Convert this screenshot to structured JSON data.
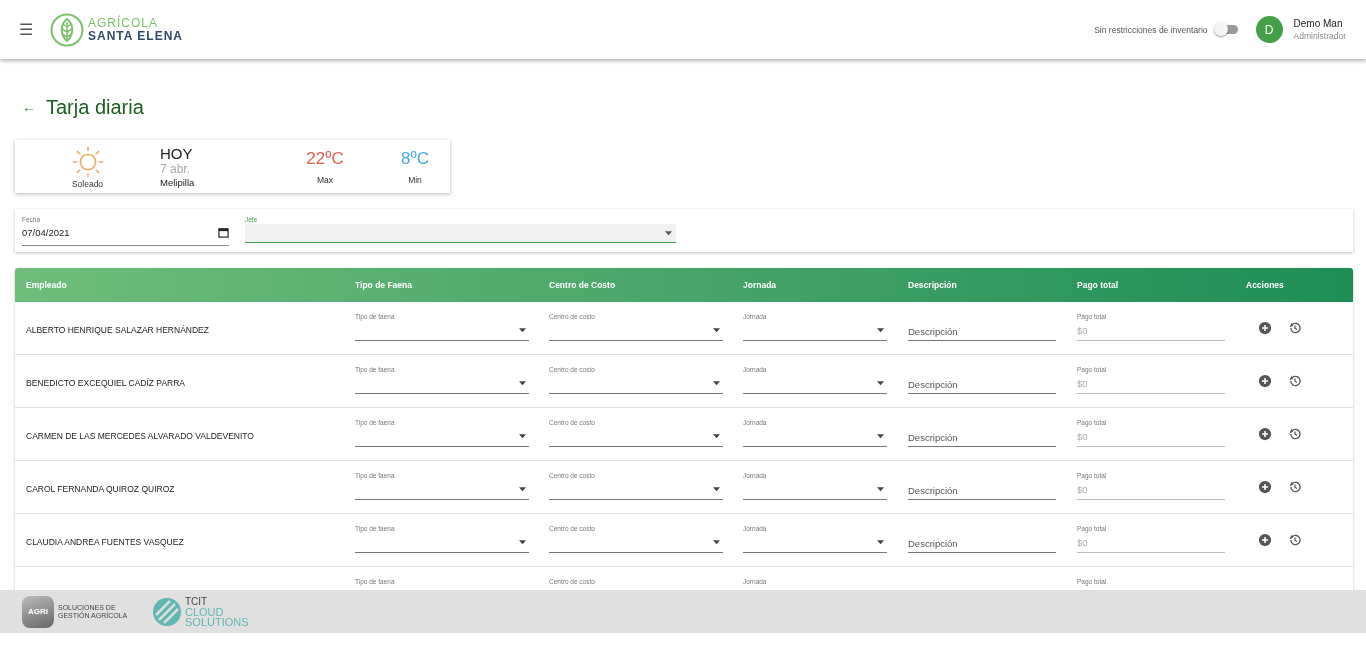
{
  "header": {
    "menu_icon": "☰",
    "logo": {
      "line1": "AGRÍCOLA",
      "line2": "SANTA ELENA"
    },
    "toggle": {
      "label": "Sin restricciones de inventario",
      "on": false
    },
    "user": {
      "initial": "D",
      "name": "Demo Man",
      "role": "Administrador"
    }
  },
  "page": {
    "back": "←",
    "title": "Tarja diaria"
  },
  "weather": {
    "condition": "Soleado",
    "day": "HOY",
    "date": "7 abr.",
    "place": "Melipilla",
    "max": "22ºC",
    "max_label": "Max",
    "min": "8ºC",
    "min_label": "Min"
  },
  "filters": {
    "fecha": {
      "label": "Fecha",
      "value": "07/04/2021"
    },
    "jefe": {
      "label": "Jefe"
    }
  },
  "table": {
    "columns": [
      "Empleado",
      "Tipo de Faena",
      "Centro de Costo",
      "Jornada",
      "Descripción",
      "Pago total",
      "Acciones"
    ],
    "rows": [
      {
        "name": "ALBERTO HENRIQUE SALAZAR HERNÁNDEZ",
        "tipo": "Tipo de faena",
        "centro": "Centro de costo",
        "jornada": "Jornada",
        "descripcion": "Descripción",
        "pago_label": "Pago total",
        "pago": "$0",
        "actions": true
      },
      {
        "name": "BENEDICTO EXCEQUIEL CADÍZ PARRA",
        "tipo": "Tipo de faena",
        "centro": "Centro de costo",
        "jornada": "Jornada",
        "descripcion": "Descripción",
        "pago_label": "Pago total",
        "pago": "$0",
        "actions": true
      },
      {
        "name": "CARMEN DE LAS MERCEDES ALVARADO VALDEVENITO",
        "tipo": "Tipo de faena",
        "centro": "Centro de costo",
        "jornada": "Jornada",
        "descripcion": "Descripción",
        "pago_label": "Pago total",
        "pago": "$0",
        "actions": true
      },
      {
        "name": "CAROL FERNANDA QUIROZ QUIROZ",
        "tipo": "Tipo de faena",
        "centro": "Centro de costo",
        "jornada": "Jornada",
        "descripcion": "Descripción",
        "pago_label": "Pago total",
        "pago": "$0",
        "actions": true
      },
      {
        "name": "CLAUDIA ANDREA FUENTES VASQUEZ",
        "tipo": "Tipo de faena",
        "centro": "Centro de costo",
        "jornada": "Jornada",
        "descripcion": "Descripción",
        "pago_label": "Pago total",
        "pago": "$0",
        "actions": true
      },
      {
        "tipo": "Tipo de faena",
        "centro": "Centro de costo",
        "jornada": "Jornada",
        "pago_label": "Pago total",
        "actions": false
      }
    ]
  },
  "footer": {
    "agri": {
      "mark": "AGRI",
      "text": "SOLUCIONES DE GESTIÓN AGRÍCOLA"
    },
    "tcit": {
      "line1": "TCIT",
      "line2": "CLOUD",
      "line3": "SOLUTIONS"
    }
  }
}
